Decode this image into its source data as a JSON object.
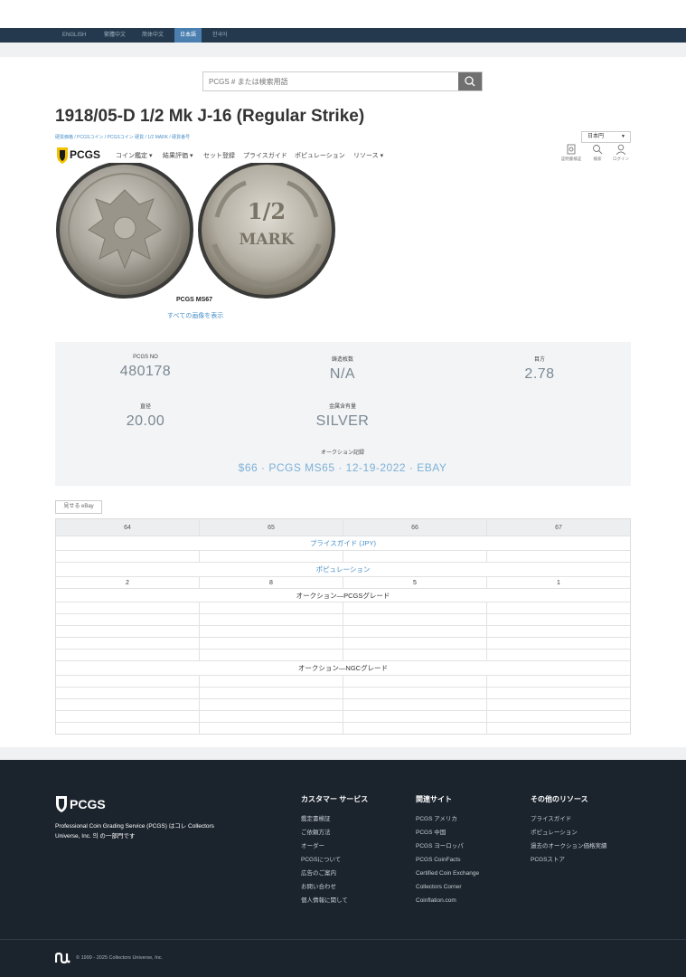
{
  "languages": [
    {
      "label": "ENGLISH",
      "active": false
    },
    {
      "label": "繁體中文",
      "active": false
    },
    {
      "label": "简体中文",
      "active": false
    },
    {
      "label": "日本語",
      "active": true
    },
    {
      "label": "한국어",
      "active": false
    }
  ],
  "search": {
    "placeholder": "PCGS # または検索用語",
    "icon": "search-icon"
  },
  "title": "1918/05-D 1/2 Mk J-16 (Regular Strike)",
  "breadcrumb": "硬貨価格 / PCGSコイン / PCGSコイン 硬貨 / 1/2 MARK / 硬貨番号",
  "nav": {
    "logo_text": "PCGS",
    "menu": [
      "コイン鑑定 ▾",
      "結果評価 ▾",
      "セット登録",
      "プライスガイド",
      "ポピュレーション",
      "リソース ▾"
    ],
    "currency": "日本円",
    "tools": [
      {
        "label": "証明書検証",
        "icon": "certificate-icon"
      },
      {
        "label": "検索",
        "icon": "search-icon"
      },
      {
        "label": "ログイン",
        "icon": "user-icon"
      }
    ]
  },
  "coin": {
    "grade": "PCGS MS67",
    "view_all": "すべての画像を表示",
    "reverse_text_top": "1/2",
    "reverse_text_bottom": "MARK"
  },
  "specs": {
    "pcgs_no_label": "PCGS NO",
    "pcgs_no": "480178",
    "mintage_label": "鋳造枚数",
    "mintage": "N/A",
    "weight_label": "目方",
    "weight": "2.78",
    "diameter_label": "直径",
    "diameter": "20.00",
    "metal_label": "金属含有量",
    "metal": "SILVER",
    "auction_label": "オークション記録",
    "auction": "$66 · PCGS MS65 · 12-19-2022 · EBAY"
  },
  "ebay_button": "見せる eBay",
  "price_table": {
    "grades": [
      "64",
      "65",
      "66",
      "67"
    ],
    "price_guide_label": "プライスガイド (JPY)",
    "population_label": "ポピュレーション",
    "population": [
      "2",
      "8",
      "5",
      "1"
    ],
    "auction_pcgs_label": "オークション—PCGSグレード",
    "auction_ngc_label": "オークション—NGCグレード"
  },
  "footer": {
    "logo_text": "PCGS",
    "description": "Professional Coin Grading Service (PCGS) はコレ Collectors Universe, Inc. 의 の一部門です",
    "columns": [
      {
        "heading": "カスタマー サービス",
        "links": [
          "鑑定書検証",
          "ご依頼方法",
          "オーダー",
          "PCGSについて",
          "広告のご案内",
          "お問い合わせ",
          "個人情報に関して"
        ]
      },
      {
        "heading": "関連サイト",
        "links": [
          "PCGS アメリカ",
          "PCGS 中国",
          "PCGS ヨーロッパ",
          "PCGS CoinFacts",
          "Certified Coin Exchange",
          "Collectors Corner",
          "Coinflation.com"
        ]
      },
      {
        "heading": "その他のリソース",
        "links": [
          "プライスガイド",
          "ポピュレーション",
          "過去のオークション価格実績",
          "PCGSストア"
        ]
      }
    ],
    "copyright": "© 1999 - 2025 Collectors Universe, Inc."
  }
}
